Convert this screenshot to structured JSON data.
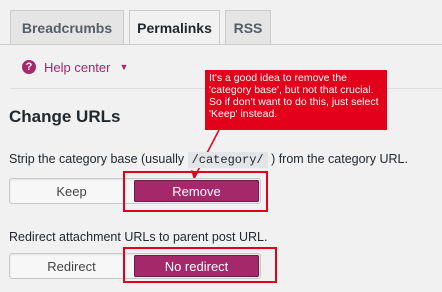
{
  "tabs": [
    {
      "label": "Breadcrumbs",
      "active": false
    },
    {
      "label": "Permalinks",
      "active": true
    },
    {
      "label": "RSS",
      "active": false
    }
  ],
  "help": {
    "label": "Help center",
    "icon": "question-icon",
    "caret": "chevron-down-icon"
  },
  "callout": {
    "text": "It's a good idea to remove the 'category base', but not that crucial. So if don't want to do this, just select 'Keep' instead."
  },
  "section": {
    "title": "Change URLs"
  },
  "strip_base": {
    "label_prefix": "Strip the category base (usually ",
    "label_code": "/category/",
    "label_suffix": " ) from the category URL.",
    "option_keep": "Keep",
    "option_remove": "Remove",
    "selected": "Remove"
  },
  "redirect_attachments": {
    "label": "Redirect attachment URLs to parent post URL.",
    "option_redirect": "Redirect",
    "option_no_redirect": "No redirect",
    "selected": "No redirect"
  },
  "colors": {
    "accent": "#a4286a",
    "annotation": "#e3001b",
    "background": "#f1f1f1"
  }
}
